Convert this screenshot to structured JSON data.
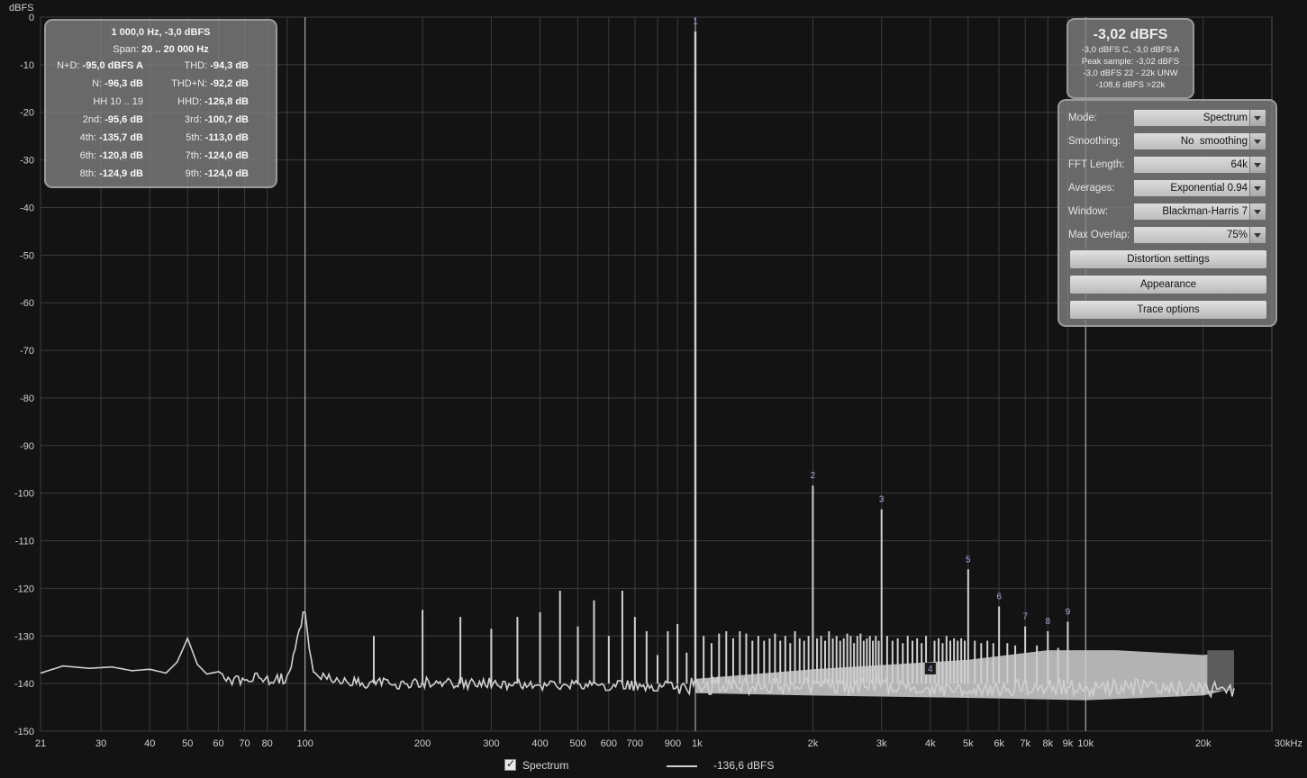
{
  "chart_data": {
    "type": "line",
    "ylabel": "dBFS",
    "xunit": "kHz",
    "xscale": "log",
    "xlim": [
      21,
      30000
    ],
    "ylim": [
      -150,
      0
    ],
    "grid": true,
    "yticks": [
      0,
      -10,
      -20,
      -30,
      -40,
      -50,
      -60,
      -70,
      -80,
      -90,
      -100,
      -110,
      -120,
      -130,
      -140,
      -150
    ],
    "xticks": [
      {
        "v": 21,
        "label": "21"
      },
      {
        "v": 30,
        "label": "30"
      },
      {
        "v": 40,
        "label": "40"
      },
      {
        "v": 50,
        "label": "50"
      },
      {
        "v": 60,
        "label": "60"
      },
      {
        "v": 70,
        "label": "70"
      },
      {
        "v": 80,
        "label": "80"
      },
      {
        "v": 100,
        "label": "100"
      },
      {
        "v": 200,
        "label": "200"
      },
      {
        "v": 300,
        "label": "300"
      },
      {
        "v": 400,
        "label": "400"
      },
      {
        "v": 500,
        "label": "500"
      },
      {
        "v": 600,
        "label": "600"
      },
      {
        "v": 700,
        "label": "700"
      },
      {
        "v": 900,
        "label": "900"
      },
      {
        "v": 1000,
        "label": "1k"
      },
      {
        "v": 2000,
        "label": "2k"
      },
      {
        "v": 3000,
        "label": "3k"
      },
      {
        "v": 4000,
        "label": "4k"
      },
      {
        "v": 5000,
        "label": "5k"
      },
      {
        "v": 6000,
        "label": "6k"
      },
      {
        "v": 7000,
        "label": "7k"
      },
      {
        "v": 8000,
        "label": "8k"
      },
      {
        "v": 9000,
        "label": "9k"
      },
      {
        "v": 10000,
        "label": "10k"
      },
      {
        "v": 20000,
        "label": "20k"
      },
      {
        "v": 30000,
        "label": "30kHz"
      }
    ],
    "x_gridlines": [
      21,
      30,
      40,
      50,
      60,
      70,
      80,
      90,
      100,
      200,
      300,
      400,
      500,
      600,
      700,
      800,
      900,
      1000,
      2000,
      3000,
      4000,
      5000,
      6000,
      7000,
      8000,
      9000,
      10000,
      20000
    ],
    "markers": [
      100,
      1000,
      10000
    ],
    "noise_floor": [
      [
        21,
        -137.8
      ],
      [
        24,
        -136.3
      ],
      [
        28,
        -136.8
      ],
      [
        32,
        -136.5
      ],
      [
        36,
        -137.3
      ],
      [
        40,
        -137.0
      ],
      [
        44,
        -137.8
      ],
      [
        47,
        -135.5
      ],
      [
        50,
        -130.5
      ],
      [
        53,
        -136.0
      ],
      [
        56,
        -138.0
      ],
      [
        60,
        -137.5
      ],
      [
        65,
        -139.2
      ],
      [
        70,
        -139.0
      ],
      [
        80,
        -139.0
      ],
      [
        90,
        -139.0
      ],
      [
        100,
        -124.5
      ],
      [
        105,
        -138.5
      ],
      [
        150,
        -140.0
      ],
      [
        200,
        -139.8
      ],
      [
        300,
        -140.0
      ],
      [
        500,
        -140.3
      ],
      [
        800,
        -140.4
      ],
      [
        1000,
        -140.5
      ],
      [
        2000,
        -140.6
      ],
      [
        5000,
        -140.8
      ],
      [
        10000,
        -140.8
      ],
      [
        20000,
        -141.0
      ],
      [
        24000,
        -141.0
      ]
    ],
    "noise_band_top": [
      [
        1000,
        -139.0
      ],
      [
        2000,
        -137.0
      ],
      [
        5000,
        -135.0
      ],
      [
        8000,
        -133.0
      ],
      [
        12000,
        -133.0
      ],
      [
        20000,
        -134.0
      ],
      [
        24000,
        -133.5
      ]
    ],
    "noise_band_bottom": [
      [
        1000,
        -142.0
      ],
      [
        2000,
        -142.5
      ],
      [
        5000,
        -143.0
      ],
      [
        10000,
        -143.5
      ],
      [
        20000,
        -142.5
      ],
      [
        24000,
        -141.0
      ]
    ],
    "spikes": [
      [
        150,
        -130.0
      ],
      [
        200,
        -124.5
      ],
      [
        250,
        -126.0
      ],
      [
        300,
        -128.5
      ],
      [
        350,
        -126.0
      ],
      [
        400,
        -125.0
      ],
      [
        450,
        -120.5
      ],
      [
        500,
        -128.0
      ],
      [
        550,
        -122.5
      ],
      [
        600,
        -130.0
      ],
      [
        650,
        -120.5
      ],
      [
        700,
        -126.0
      ],
      [
        750,
        -129.0
      ],
      [
        800,
        -134.0
      ],
      [
        850,
        -129.0
      ],
      [
        900,
        -127.5
      ],
      [
        950,
        -133.5
      ],
      [
        1000,
        -3.02
      ],
      [
        1050,
        -130.0
      ],
      [
        1100,
        -131.5
      ],
      [
        1150,
        -129.5
      ],
      [
        1200,
        -129.0
      ],
      [
        1250,
        -130.5
      ],
      [
        1300,
        -129.0
      ],
      [
        1350,
        -129.5
      ],
      [
        1400,
        -131.0
      ],
      [
        1450,
        -130.0
      ],
      [
        1500,
        -131.0
      ],
      [
        1550,
        -130.5
      ],
      [
        1600,
        -129.5
      ],
      [
        1650,
        -131.0
      ],
      [
        1700,
        -130.0
      ],
      [
        1750,
        -131.5
      ],
      [
        1800,
        -129.0
      ],
      [
        1850,
        -130.5
      ],
      [
        1900,
        -131.0
      ],
      [
        1950,
        -130.0
      ],
      [
        2000,
        -98.4
      ],
      [
        2050,
        -130.5
      ],
      [
        2100,
        -130.0
      ],
      [
        2150,
        -131.0
      ],
      [
        2200,
        -129.0
      ],
      [
        2250,
        -130.5
      ],
      [
        2300,
        -130.0
      ],
      [
        2350,
        -131.0
      ],
      [
        2400,
        -130.5
      ],
      [
        2450,
        -129.5
      ],
      [
        2500,
        -130.0
      ],
      [
        2550,
        -131.5
      ],
      [
        2600,
        -130.0
      ],
      [
        2650,
        -129.5
      ],
      [
        2700,
        -131.0
      ],
      [
        2750,
        -130.5
      ],
      [
        2800,
        -130.0
      ],
      [
        2850,
        -131.0
      ],
      [
        2900,
        -130.0
      ],
      [
        2950,
        -131.0
      ],
      [
        3000,
        -103.4
      ],
      [
        3100,
        -130.0
      ],
      [
        3200,
        -131.0
      ],
      [
        3300,
        -130.5
      ],
      [
        3400,
        -131.5
      ],
      [
        3500,
        -130.0
      ],
      [
        3600,
        -131.0
      ],
      [
        3700,
        -130.5
      ],
      [
        3800,
        -131.5
      ],
      [
        3900,
        -130.0
      ],
      [
        4000,
        -135.7
      ],
      [
        4100,
        -131.0
      ],
      [
        4200,
        -130.5
      ],
      [
        4300,
        -131.5
      ],
      [
        4400,
        -130.0
      ],
      [
        4500,
        -131.0
      ],
      [
        4600,
        -130.5
      ],
      [
        4700,
        -131.0
      ],
      [
        4800,
        -130.5
      ],
      [
        4900,
        -131.0
      ],
      [
        5000,
        -116.0
      ],
      [
        5200,
        -131.0
      ],
      [
        5400,
        -131.5
      ],
      [
        5600,
        -131.0
      ],
      [
        5800,
        -131.5
      ],
      [
        6000,
        -123.8
      ],
      [
        6300,
        -131.5
      ],
      [
        6600,
        -132.0
      ],
      [
        7000,
        -128.0
      ],
      [
        7500,
        -132.0
      ],
      [
        8000,
        -129.0
      ],
      [
        8500,
        -132.5
      ],
      [
        9000,
        -127.0
      ]
    ],
    "harmonic_labels": [
      {
        "label": "1",
        "x": 1000,
        "y": -3.02
      },
      {
        "label": "2",
        "x": 2000,
        "y": -98.4
      },
      {
        "label": "3",
        "x": 3000,
        "y": -103.4
      },
      {
        "label": "4",
        "x": 4000,
        "y": -135.7
      },
      {
        "label": "5",
        "x": 5000,
        "y": -116.0
      },
      {
        "label": "6",
        "x": 6000,
        "y": -123.8
      },
      {
        "label": "7",
        "x": 7000,
        "y": -128.0
      },
      {
        "label": "8",
        "x": 8000,
        "y": -129.0
      },
      {
        "label": "9",
        "x": 9000,
        "y": -127.0
      }
    ],
    "series": [
      {
        "name": "Spectrum",
        "color": "#d0d0d0"
      }
    ]
  },
  "stats": {
    "line1": "1 000,0 Hz, -3,0 dBFS",
    "span_label": "Span:",
    "span_value": "20 .. 20 000 Hz",
    "rows": [
      {
        "l_label": "N+D:",
        "l_value": "-95,0 dBFS A",
        "r_label": "THD:",
        "r_value": "-94,3 dB"
      },
      {
        "l_label": "N:",
        "l_value": "-96,3 dB",
        "r_label": "THD+N:",
        "r_value": "-92,2 dB"
      },
      {
        "l_label": "HH 10 .. 19",
        "l_value": "",
        "r_label": "HHD:",
        "r_value": "-126,8 dB"
      },
      {
        "l_label": "2nd:",
        "l_value": "-95,6 dB",
        "r_label": "3rd:",
        "r_value": "-100,7 dB"
      },
      {
        "l_label": "4th:",
        "l_value": "-135,7 dB",
        "r_label": "5th:",
        "r_value": "-113,0 dB"
      },
      {
        "l_label": "6th:",
        "l_value": "-120,8 dB",
        "r_label": "7th:",
        "r_value": "-124,0 dB"
      },
      {
        "l_label": "8th:",
        "l_value": "-124,9 dB",
        "r_label": "9th:",
        "r_value": "-124,0 dB"
      }
    ]
  },
  "level": {
    "main": "-3,02 dBFS",
    "line1": "-3,0 dBFS C, -3,0 dBFS A",
    "line2": "Peak sample: -3,02 dBFS",
    "line3": "-3,0 dBFS 22 - 22k UNW",
    "line4": "-108,6 dBFS >22k"
  },
  "controls": {
    "mode": {
      "label": "Mode:",
      "value": "Spectrum"
    },
    "smoothing": {
      "label": "Smoothing:",
      "value": "No  smoothing"
    },
    "fft_length": {
      "label": "FFT Length:",
      "value": "64k"
    },
    "averages": {
      "label": "Averages:",
      "value": "Exponential 0.94"
    },
    "window": {
      "label": "Window:",
      "value": "Blackman-Harris 7"
    },
    "max_overlap": {
      "label": "Max Overlap:",
      "value": "75%"
    },
    "distortion_btn": "Distortion settings",
    "appearance_btn": "Appearance",
    "trace_btn": "Trace options"
  },
  "legend": {
    "name": "Spectrum",
    "value": "-136,6 dBFS"
  }
}
